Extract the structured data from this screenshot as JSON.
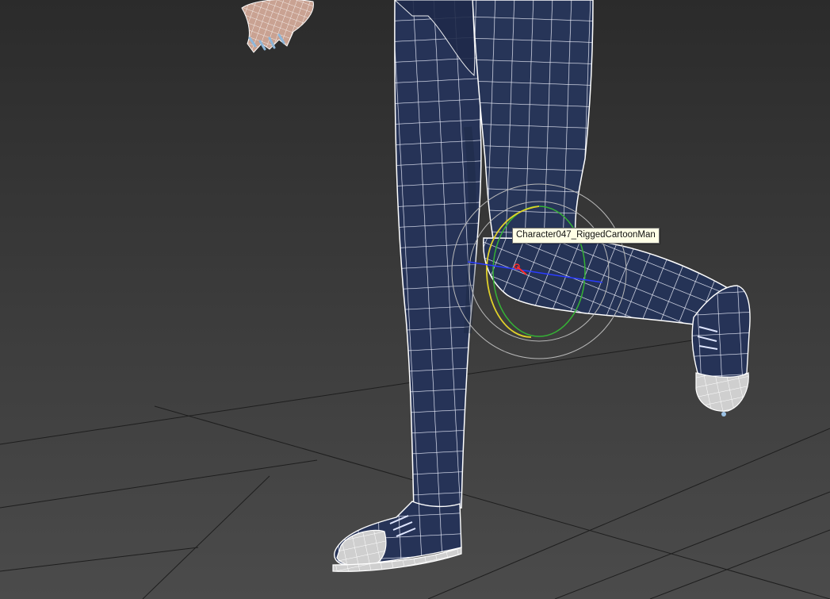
{
  "viewport": {
    "background_top": "#2c2c2c",
    "background_bottom": "#4a4a4a",
    "grid_color": "#1e1e1e",
    "mesh_fill": "#263357",
    "mesh_fill_dark": "#1c2747",
    "wire_color": "#f2f2f2",
    "shoe_fill": "#cfcfcf",
    "hand_fill": "#c7a08f"
  },
  "gizmo": {
    "x_axis_color": "#ff2a2a",
    "y_axis_color": "#2abf2a",
    "z_axis_color": "#2a3cff",
    "ring_yellow": "#e0d12a",
    "ring_green": "#35b335",
    "ring_outer": "#b8b8b8"
  },
  "tooltip": {
    "label": "Character047_RiggedCartoonMan",
    "background": "#ffffe6",
    "text_color": "#111111"
  }
}
